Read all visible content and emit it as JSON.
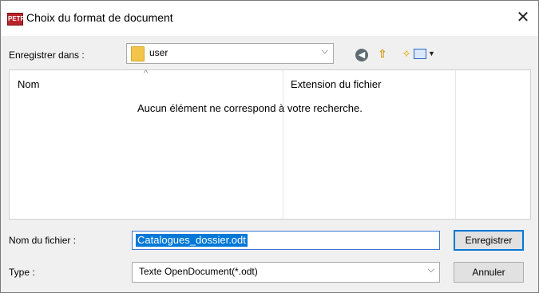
{
  "window": {
    "title": "Choix du format de document",
    "app_icon_text": "PETRA"
  },
  "save_in": {
    "label": "Enregistrer dans :",
    "value": "user"
  },
  "toolbar": {
    "back_icon": "back-arrow-icon",
    "up_icon": "up-folder-icon",
    "new_folder_icon": "new-folder-icon",
    "view_icon": "view-menu-icon"
  },
  "file_list": {
    "columns": [
      "Nom",
      "Extension du fichier"
    ],
    "empty_message": "Aucun élément ne correspond à votre recherche."
  },
  "filename": {
    "label": "Nom du fichier :",
    "value": "Catalogues_dossier.odt"
  },
  "type": {
    "label": "Type :",
    "value": "Texte OpenDocument(*.odt)"
  },
  "buttons": {
    "save": "Enregistrer",
    "cancel": "Annuler"
  }
}
